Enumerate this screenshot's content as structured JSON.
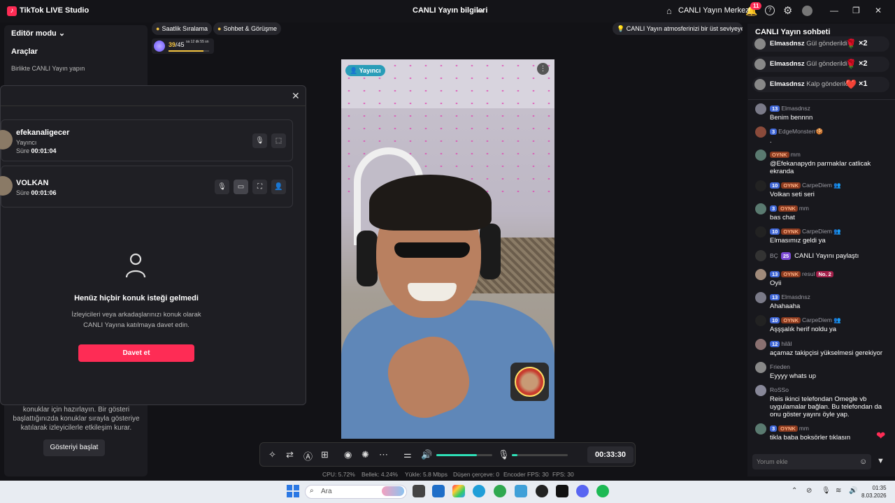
{
  "titlebar": {
    "app_name": "TikTok LIVE Studio",
    "center_title": "CANLI Yayın bilgileri",
    "hub_label": "CANLI Yayın Merkezi",
    "notif_count": "11"
  },
  "left_panel": {
    "mode_label": "Editör modu",
    "tools_label": "Araçlar",
    "collab_label": "Birlikte CANLI Yayın yapın",
    "desc": "konuklar için hazırlayın. Bir gösteri başlattığınızda konuklar sırayla gösteriye katılarak izleyicilerle etkileşim kurar.",
    "show_button": "Gösteriyi başlat"
  },
  "modal": {
    "guests": [
      {
        "name": "efekanaligecer",
        "role": "Yayıncı",
        "time_label": "Süre",
        "time": "00:01:04"
      },
      {
        "name": "VOLKAN",
        "role": "",
        "time_label": "Süre",
        "time": "00:01:06"
      }
    ],
    "empty_title": "Henüz hiçbir konuk isteği gelmedi",
    "empty_desc": "İzleyicileri veya arkadaşlarınızı konuk olarak CANLI Yayına katılmaya davet edin.",
    "invite_button": "Davet et"
  },
  "chips": {
    "ranking": "Saatlik Sıralama",
    "chat_meet": "Sohbet & Görüşme",
    "announce": "CANLI Yayın atmosferinizi bir üst seviyeye ..."
  },
  "score": {
    "value": "39",
    "total": "/45",
    "time": "sa 12 dk 55 sn",
    "progress": 0.87
  },
  "video": {
    "host_badge": "Yayıncı"
  },
  "controls": {
    "timer": "00:33:30",
    "volume": 0.72,
    "mic": 0.1
  },
  "stats": {
    "cpu": "CPU:  5.72%",
    "memory": "Bellek:  4.24%",
    "upload": "Yükle:  5.8 Mbps",
    "dropped": "Düşen çerçeve:  0",
    "encoder": "Encoder FPS:  30",
    "fps": "FPS:  30"
  },
  "chat": {
    "title": "CANLI Yayın sohbeti",
    "gifts": [
      {
        "user": "Elmasdnsz",
        "action": "Gül gönderildi",
        "icon": "🌹",
        "count": "×2"
      },
      {
        "user": "Elmasdnsz",
        "action": "Gül gönderildi",
        "icon": "🌹",
        "count": "×2"
      },
      {
        "user": "Elmasdnsz",
        "action": "Kalp gönderildi",
        "icon": "❤️",
        "count": "×1"
      }
    ],
    "messages": [
      {
        "level": "13",
        "tag": "",
        "user": "Elmasdnsz",
        "text": "Benim bennnn"
      },
      {
        "level": "3",
        "tag": "",
        "user": "EdgeMonsterr🍪",
        "text": "."
      },
      {
        "level": "",
        "tag": "OYNK",
        "user": "mm",
        "text": "@Efekanapydn parmaklar catlicak ekranda"
      },
      {
        "level": "10",
        "tag": "OYNK",
        "user": "CarpeDiem 👥",
        "text": "Volkan seti seri"
      },
      {
        "level": "3",
        "tag": "OYNK",
        "user": "mm",
        "text": "bas chat"
      },
      {
        "level": "10",
        "tag": "OYNK",
        "user": "CarpeDiem 👥",
        "text": "Elmasımız geldi ya"
      },
      {
        "level": "25",
        "tag": "",
        "user": "BÇ",
        "text": "CANLI Yayını paylaştı"
      },
      {
        "level": "13",
        "tag": "OYNK",
        "user": "resul",
        "text": "Oyii",
        "rank": "No. 2"
      },
      {
        "level": "13",
        "tag": "",
        "user": "Elmasdnsz",
        "text": "Ahahaaha"
      },
      {
        "level": "10",
        "tag": "OYNK",
        "user": "CarpeDiem 👥",
        "text": "Aşşşalık herif noldu ya"
      },
      {
        "level": "12",
        "tag": "",
        "user": "hilâl",
        "text": "açamaz takipçisi yükselmesi gerekiyor"
      },
      {
        "level": "",
        "tag": "",
        "user": "Frieden",
        "text": "Eyyyy whats up"
      },
      {
        "level": "",
        "tag": "",
        "user": "RoSSo",
        "text": "Reis ikinci telefondan Omegle vb uygulamalar bağlan. Bu telefondan da onu göster yayını öyle yap."
      },
      {
        "level": "3",
        "tag": "OYNK",
        "user": "mm",
        "text": "tikla baba boksörler tıklasın"
      }
    ],
    "input_placeholder": "Yorum ekle"
  },
  "taskbar": {
    "search": "Ara",
    "time": "01:35",
    "date": "8.03.2026"
  },
  "colors": {
    "accent": "#fe2c55",
    "teal": "#2ee0b7",
    "level_blue": "#3f66d6"
  }
}
